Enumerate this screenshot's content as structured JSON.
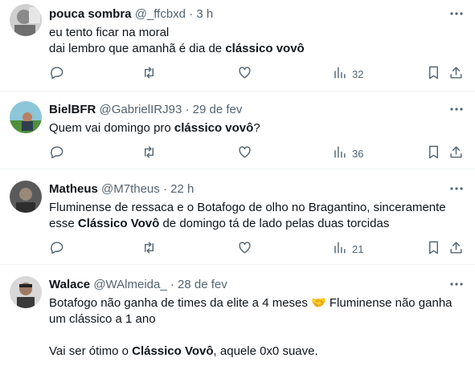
{
  "tweets": [
    {
      "name": "pouca sombra",
      "handle": "@_ffcbxd",
      "time": "3 h",
      "text_parts": [
        {
          "t": "eu tento ficar na moral\ndai lembro que amanhã é dia de ",
          "b": false
        },
        {
          "t": "clássico vovô",
          "b": true
        }
      ],
      "views": "32"
    },
    {
      "name": "BielBFR",
      "handle": "@GabrielIRJ93",
      "time": "29 de fev",
      "text_parts": [
        {
          "t": "Quem vai domingo pro ",
          "b": false
        },
        {
          "t": "clássico vovô",
          "b": true
        },
        {
          "t": "?",
          "b": false
        }
      ],
      "views": "36"
    },
    {
      "name": "Matheus",
      "handle": "@M7theus",
      "time": "22 h",
      "text_parts": [
        {
          "t": "Fluminense de ressaca e o Botafogo de olho no Bragantino, sinceramente\nesse ",
          "b": false
        },
        {
          "t": "Clássico Vovô",
          "b": true
        },
        {
          "t": " de domingo tá de lado pelas duas torcidas",
          "b": false
        }
      ],
      "views": "21"
    },
    {
      "name": "Walace",
      "handle": "@WAlmeida_",
      "time": "28 de fev",
      "text_parts": [
        {
          "t": "Botafogo não ganha de times da elite a 4 meses 🤝 Fluminense não ganha\num clássico a 1 ano\n\nVai ser ótimo o ",
          "b": false
        },
        {
          "t": "Clássico Vovô",
          "b": true
        },
        {
          "t": ", aquele 0x0 suave.",
          "b": false
        }
      ],
      "views": ""
    }
  ],
  "separator": "·",
  "icons": {
    "more": "more-icon",
    "reply": "reply-icon",
    "retweet": "retweet-icon",
    "like": "like-icon",
    "views": "views-icon",
    "bookmark": "bookmark-icon",
    "share": "share-icon"
  },
  "colors": {
    "text": "#0f1419",
    "secondary": "#536471",
    "divider": "#eff3f4"
  }
}
